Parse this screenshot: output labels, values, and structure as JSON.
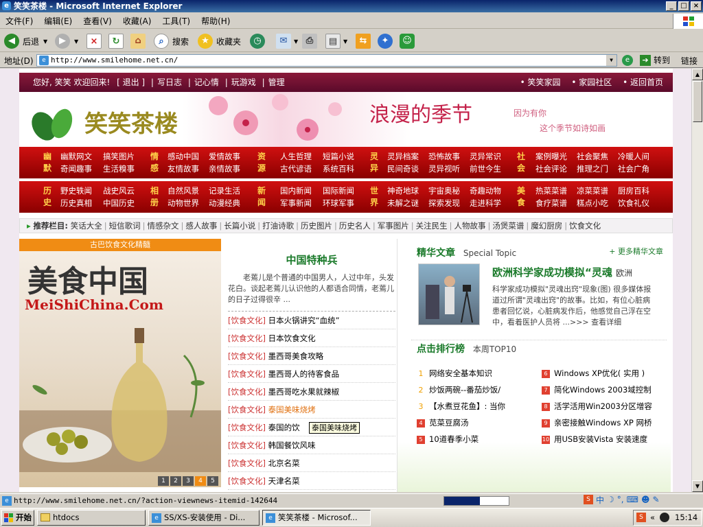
{
  "window": {
    "title": "笑笑茶楼 - Microsoft Internet Explorer"
  },
  "menu": [
    "文件(F)",
    "编辑(E)",
    "查看(V)",
    "收藏(A)",
    "工具(T)",
    "帮助(H)"
  ],
  "toolbar": {
    "back": "后退",
    "search": "搜索",
    "favorites": "收藏夹"
  },
  "address": {
    "label": "地址(D)",
    "url": "http://www.smilehome.net.cn/",
    "go": "转到",
    "links": "链接"
  },
  "site": {
    "topbar_left": [
      "您好, 笑笑  欢迎回来!",
      "[ 退出 ]",
      "写日志",
      "记心情",
      "玩游戏",
      "管理"
    ],
    "topbar_right": [
      "• 笑笑家园",
      "• 家园社区",
      "• 返回首页"
    ],
    "logo": "笑笑茶楼",
    "slogan": "浪漫的季节",
    "sub1": "因为有你",
    "sub2": "这个季节如诗如画",
    "nav1": {
      "cats": [
        [
          "幽",
          "默"
        ],
        [
          "情",
          "感"
        ],
        [
          "资",
          "源"
        ],
        [
          "灵",
          "异"
        ],
        [
          "社",
          "会"
        ]
      ],
      "links": [
        [
          "幽默网文",
          "搞笑图片",
          "奇闻趣事",
          "生活糗事"
        ],
        [
          "感动中国",
          "爱情故事",
          "友情故事",
          "亲情故事"
        ],
        [
          "人生哲理",
          "短篇小说",
          "古代谚语",
          "系统百科"
        ],
        [
          "灵异档案",
          "恐怖故事",
          "灵异常识",
          "民间奇谈",
          "灵异视听",
          "前世今生"
        ],
        [
          "案例曝光",
          "社会聚焦",
          "冷暖人间",
          "社会评论",
          "推理之门",
          "社会广角"
        ]
      ]
    },
    "nav2": {
      "cats": [
        [
          "历",
          "史"
        ],
        [
          "相",
          "册"
        ],
        [
          "新",
          "闻"
        ],
        [
          "世",
          "界"
        ],
        [
          "美",
          "食"
        ]
      ],
      "links": [
        [
          "野史轶闻",
          "战史风云",
          "历史真相",
          "中国历史"
        ],
        [
          "自然风景",
          "记录生活",
          "动物世界",
          "动漫经典"
        ],
        [
          "国内新闻",
          "国际新闻",
          "军事新闻",
          "环球军事"
        ],
        [
          "神奇地球",
          "宇宙奥秘",
          "奇趣动物",
          "未解之谜",
          "探索发现",
          "走进科学"
        ],
        [
          "热菜菜谱",
          "凉菜菜谱",
          "厨房百科",
          "食疗菜谱",
          "糕点小吃",
          "饮食礼仪"
        ]
      ]
    },
    "recommend_label": "推荐栏目:",
    "recommend": [
      "笑话大全",
      "短信歌词",
      "情感杂文",
      "感人故事",
      "长篇小说",
      "打油诗歌",
      "历史图片",
      "历史名人",
      "军事图片",
      "关注民生",
      "人物故事",
      "汤煲菜谱",
      "魔幻厨房",
      "饮食文化"
    ],
    "feature": {
      "header": "古巴饮食文化精髓",
      "title": "美食中国",
      "site": "MeiShiChina.Com",
      "pages": [
        "1",
        "2",
        "3",
        "4",
        "5"
      ]
    },
    "mid_title": "中国特种兵",
    "mid_desc": "老蔫儿是个普通的中国男人，人过中年，头发花白。谈起老蔫儿认识他的人都语合同情，老蔫儿的日子过得很辛 ...",
    "articles": [
      {
        "cat": "[饮食文化]",
        "title": "日本火锅讲究“血统”"
      },
      {
        "cat": "[饮食文化]",
        "title": "日本饮食文化"
      },
      {
        "cat": "[饮食文化]",
        "title": "墨西哥美食攻略"
      },
      {
        "cat": "[饮食文化]",
        "title": "墨西哥人的待客食品"
      },
      {
        "cat": "[饮食文化]",
        "title": "墨西哥吃水果就辣椒"
      },
      {
        "cat": "[饮食文化]",
        "title": "泰国美味烧烤"
      },
      {
        "cat": "[饮食文化]",
        "title": "泰国的饮"
      },
      {
        "cat": "[饮食文化]",
        "title": "韩国餐饮风味"
      },
      {
        "cat": "[饮食文化]",
        "title": "北京名菜"
      },
      {
        "cat": "[饮食文化]",
        "title": "天津名菜"
      }
    ],
    "tooltip": "泰国美味烧烤",
    "special": {
      "title": "精华文章",
      "en": "Special Topic",
      "more": "+ 更多精华文章",
      "headline": "欧洲科学家成功模拟“灵魂",
      "headline_tail": "欧洲",
      "body": "科学家成功模拟\"灵魂出窍\"现象(图) 很多媒体报道过所谓\"灵魂出窍\"的故事。比如，有位心脏病患者回忆说，心脏病发作后，他感觉自己浮在空中，看着医护人员将 ...>>> 查看详细"
    },
    "rank": {
      "title": "点击排行榜",
      "sub": "本周TOP10",
      "left": [
        {
          "n": "1",
          "t": "网络安全基本知识"
        },
        {
          "n": "2",
          "t": "炒饭两碗--番茄炒饭/"
        },
        {
          "n": "3",
          "t": "【水煮豆花鱼】: 当你"
        },
        {
          "n": "4",
          "t": "苋菜豆腐汤"
        },
        {
          "n": "5",
          "t": "10道春季小菜"
        }
      ],
      "right": [
        {
          "n": "6",
          "t": "Windows XP优化( 实用 )"
        },
        {
          "n": "7",
          "t": "简化Windows 2003域控制"
        },
        {
          "n": "8",
          "t": "活学活用Win2003分区增容"
        },
        {
          "n": "9",
          "t": "亲密接触Windows XP 网桥"
        },
        {
          "n": "10",
          "t": "用USB安装Vista 安装速度"
        }
      ]
    }
  },
  "status": {
    "url": "http://www.smilehome.net.cn/?action-viewnews-itemid-142644"
  },
  "taskbar": {
    "start": "开始",
    "tasks": [
      "htdocs",
      "SS/XS-安装使用 - Di...",
      "笑笑茶楼 - Microsof..."
    ],
    "tray_ime": "中",
    "time": "15:14"
  }
}
